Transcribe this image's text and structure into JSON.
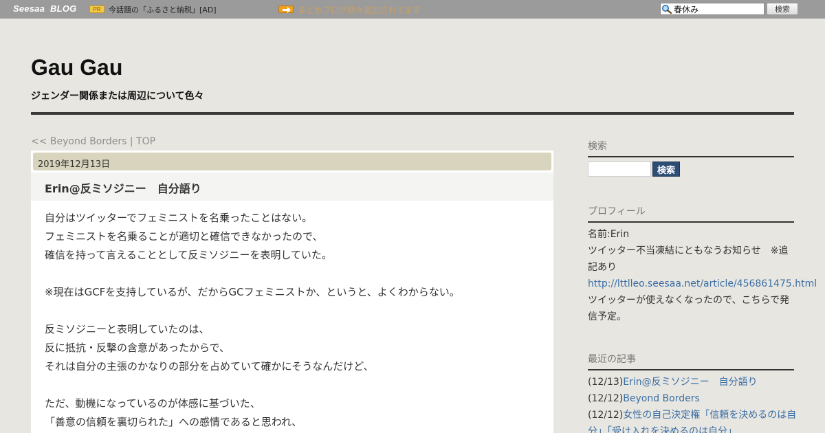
{
  "topbar": {
    "logo_seesaa": "Seesaa",
    "logo_blog": "BLOG",
    "pr_badge": "PR",
    "pr_text": "今話題の「ふるさと納税」[AD]",
    "notice_text": "まとめブログ続々追加されてます",
    "search_value": "春休み",
    "search_button": "検索"
  },
  "header": {
    "title": "Gau Gau",
    "description": "ジェンダー関係または周辺について色々"
  },
  "pager": {
    "prev_label": "<< Beyond Borders",
    "separator": " | ",
    "top_label": "TOP"
  },
  "article": {
    "date": "2019年12月13日",
    "title": "Erin@反ミソジニー　自分語り",
    "lines": [
      "自分はツイッターでフェミニストを名乗ったことはない。",
      "フェミニストを名乗ることが適切と確信できなかったので、",
      "確信を持って言えることとして反ミソジニーを表明していた。",
      "",
      "※現在はGCFを支持しているが、だからGCフェミニストか、というと、よくわからない。",
      "",
      "反ミソジニーと表明していたのは、",
      "反に抵抗・反撃の含意があったからで、",
      "それは自分の主張のかなりの部分を占めていて確かにそうなんだけど、",
      "",
      "ただ、動機になっているのが体感に基づいた、",
      "「善意の信頼を裏切られた」への感情であると思われ、"
    ]
  },
  "sidebar": {
    "search_heading": "検索",
    "search_button": "検索",
    "profile_heading": "プロフィール",
    "profile_name": "名前:Erin",
    "profile_note_1": "ツイッター不当凍結にともなうお知らせ　※追",
    "profile_note_2": "記あり",
    "profile_link": "http://lttlleo.seesaa.net/article/456861475.html",
    "profile_after_1": "ツイッターが使えなくなったので、こちらで発",
    "profile_after_2": "信予定。",
    "recent_heading": "最近の記事",
    "recent": [
      {
        "date": "(12/13)",
        "title": "Erin@反ミソジニー　自分語り"
      },
      {
        "date": "(12/12)",
        "title": "Beyond Borders"
      },
      {
        "date": "(12/12)",
        "title": "女性の自己決定権「信頼を決めるのは自"
      },
      {
        "date": "",
        "title": "分」「受け入れを決めるのは自分」"
      }
    ]
  }
}
